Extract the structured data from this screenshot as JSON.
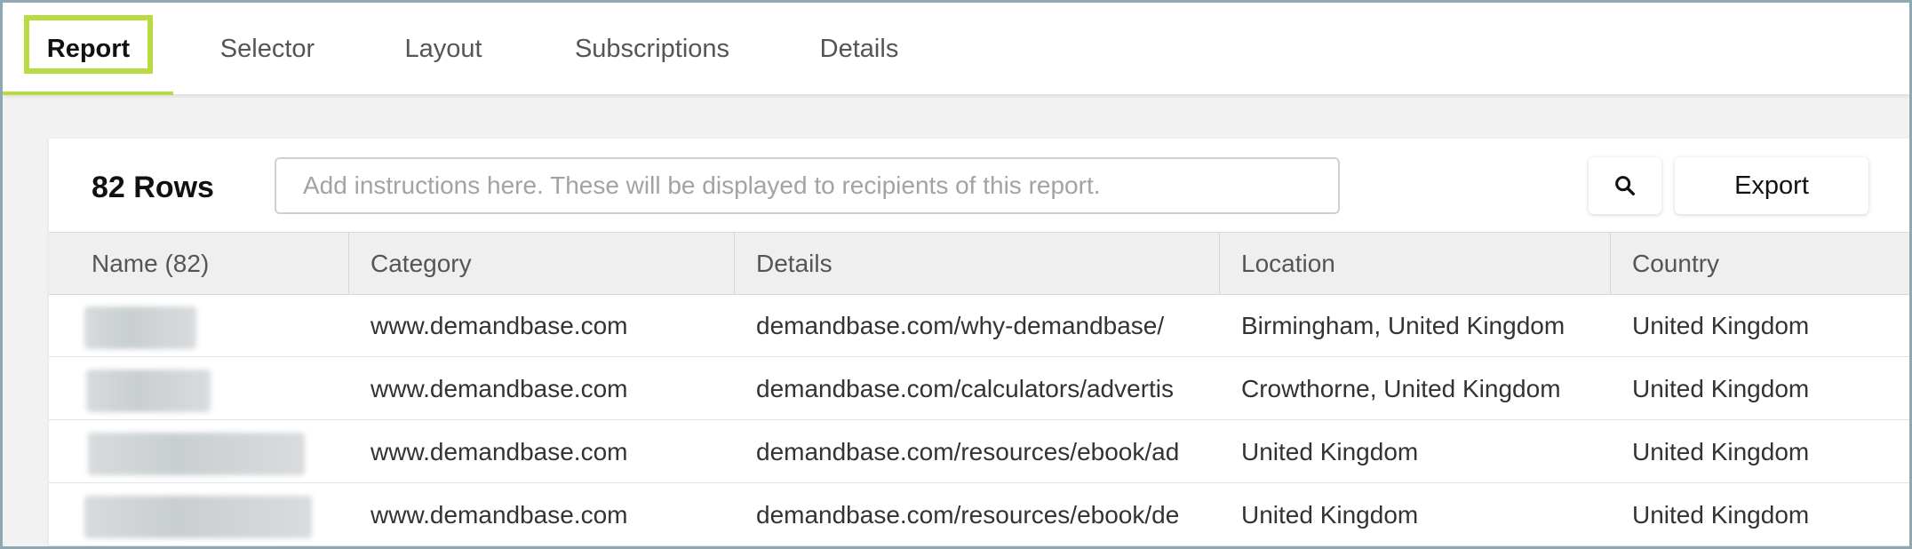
{
  "tabs": [
    {
      "label": "Report",
      "active": true
    },
    {
      "label": "Selector",
      "active": false
    },
    {
      "label": "Layout",
      "active": false
    },
    {
      "label": "Subscriptions",
      "active": false
    },
    {
      "label": "Details",
      "active": false
    }
  ],
  "colors": {
    "accent": "#b7db41"
  },
  "report": {
    "rows_label": "82 Rows",
    "instructions_placeholder": "Add instructions here. These will be displayed to recipients of this report.",
    "search_icon": "search-icon",
    "export_label": "Export"
  },
  "table": {
    "columns": [
      "Name (82)",
      "Category",
      "Details",
      "Location",
      "Country"
    ],
    "rows": [
      {
        "category": "www.demandbase.com",
        "details": "demandbase.com/why-demandbase/",
        "location": "Birmingham, United Kingdom",
        "country": "United Kingdom"
      },
      {
        "category": "www.demandbase.com",
        "details": "demandbase.com/calculators/advertis",
        "location": "Crowthorne, United Kingdom",
        "country": "United Kingdom"
      },
      {
        "category": "www.demandbase.com",
        "details": "demandbase.com/resources/ebook/ad",
        "location": "United Kingdom",
        "country": "United Kingdom"
      },
      {
        "category": "www.demandbase.com",
        "details": "demandbase.com/resources/ebook/de",
        "location": "United Kingdom",
        "country": "United Kingdom"
      }
    ]
  }
}
